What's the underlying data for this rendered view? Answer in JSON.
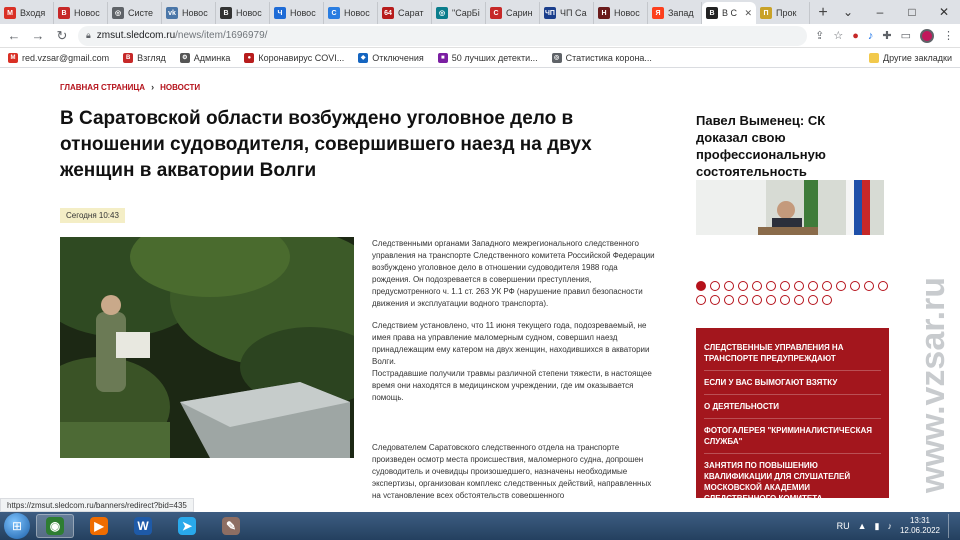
{
  "browser": {
    "tabs": [
      {
        "title": "Входя",
        "icon": "gmail-icon",
        "color": "#d93025",
        "glyph": "M"
      },
      {
        "title": "Новос",
        "icon": "vzglyad-icon",
        "color": "#c62828",
        "glyph": "В"
      },
      {
        "title": "Систе",
        "icon": "globe-icon",
        "color": "#5f6368",
        "glyph": "◎"
      },
      {
        "title": "Новос",
        "icon": "vk-icon",
        "color": "#4a76a8",
        "glyph": "vk"
      },
      {
        "title": "Новос",
        "icon": "vzglyad-icon",
        "color": "#333333",
        "glyph": "В"
      },
      {
        "title": "Новос",
        "icon": "ch-icon",
        "color": "#1e6bd6",
        "glyph": "Ч"
      },
      {
        "title": "Новос",
        "icon": "s-icon",
        "color": "#2a7de1",
        "glyph": "С"
      },
      {
        "title": "Сарат",
        "icon": "64-icon",
        "color": "#b71c1c",
        "glyph": "64"
      },
      {
        "title": "\"СарБі",
        "icon": "globe-icon",
        "color": "#0a7d8c",
        "glyph": "◎"
      },
      {
        "title": "Сарин",
        "icon": "sarinform-icon",
        "color": "#c62828",
        "glyph": "С"
      },
      {
        "title": "ЧП Са",
        "icon": "chp-icon",
        "color": "#1a3e8c",
        "glyph": "ЧП"
      },
      {
        "title": "Новос",
        "icon": "news-icon",
        "color": "#6a1b1b",
        "glyph": "Н"
      },
      {
        "title": "Запад",
        "icon": "yandex-icon",
        "color": "#fc3f1d",
        "glyph": "Я"
      },
      {
        "title": "В С",
        "icon": "sk-icon",
        "color": "#222222",
        "glyph": "В"
      },
      {
        "title": "Прок",
        "icon": "prok-icon",
        "color": "#c9a227",
        "glyph": "П"
      }
    ],
    "active_tab_index": 13,
    "new_tab_symbol": "+",
    "url_host": "zmsut.sledcom.ru",
    "url_path": "/news/item/1696979/",
    "bookmarks": [
      {
        "label": "red.vzsar@gmail.com",
        "icon": "gmail-icon",
        "color": "#d93025",
        "glyph": "M"
      },
      {
        "label": "Взгляд",
        "icon": "vzglyad-icon",
        "color": "#c62828",
        "glyph": "В"
      },
      {
        "label": "Админка",
        "icon": "gear-icon",
        "color": "#555555",
        "glyph": "⚙"
      },
      {
        "label": "Коронавирус COVI...",
        "icon": "covid-icon",
        "color": "#b71c1c",
        "glyph": "●"
      },
      {
        "label": "Отключения",
        "icon": "alert-icon",
        "color": "#1565c0",
        "glyph": "◆"
      },
      {
        "label": "50 лучших детекти...",
        "icon": "book-icon",
        "color": "#7b1fa2",
        "glyph": "■"
      },
      {
        "label": "Статистика корона...",
        "icon": "globe-icon",
        "color": "#5f6368",
        "glyph": "◎"
      }
    ],
    "other_bookmarks": "Другие закладки",
    "status_url": "https://zmsut.sledcom.ru/banners/redirect?bid=435"
  },
  "page": {
    "breadcrumbs": [
      "ГЛАВНАЯ СТРАНИЦА",
      "НОВОСТИ"
    ],
    "headline": "В Саратовской области возбуждено уголовное дело в отношении судоводителя, совершившего наезд на двух женщин в акватории Волги",
    "date": "Сегодня 10:43",
    "paragraphs": [
      "Следственными органами Западного межрегионального следственного управления на транспорте Следственного комитета Российской Федерации возбуждено уголовное дело в отношении судоводителя 1988 года рождения. Он подозревается в совершении преступления, предусмотренного ч. 1.1 ст. 263 УК РФ (нарушение правил безопасности движения и эксплуатации водного транспорта).",
      "Следствием  установлено, что 11 июня текущего года, подозреваемый, не имея права на управление маломерным судном, совершил наезд принадлежащим ему катером на двух женщин, находившихся в акватории Волги.",
      "Пострадавшие получили травмы различной степени тяжести, в настоящее время они находятся в медицинском учреждении, где им оказывается помощь."
    ],
    "paragraph_last": "Следователем Саратовского следственного отдела на транспорте произведен осмотр места происшествия, маломерного судна, допрошен судоводитель и очевидцы произошедшего, назначены необходимые экспертизы, организован комплекс следственных действий, направленных на установление всех обстоятельств совершенного",
    "sidebar": {
      "teaser_title": "Павел Выменец: СК доказал свою профессиональную состоятельность",
      "dots_total": 24,
      "dots_active_index": 0,
      "links": [
        "СЛЕДСТВЕННЫЕ УПРАВЛЕНИЯ НА ТРАНСПОРТЕ ПРЕДУПРЕЖДАЮТ",
        "ЕСЛИ У ВАС ВЫМОГАЮТ ВЗЯТКУ",
        "О ДЕЯТЕЛЬНОСТИ",
        "ФОТОГАЛЕРЕЯ \"КРИМИНАЛИСТИЧЕСКАЯ СЛУЖБА\"",
        "ЗАНЯТИЯ ПО ПОВЫШЕНИЮ КВАЛИФИКАЦИИ ДЛЯ СЛУШАТЕЛЕЙ МОСКОВСКОЙ АКАДЕМИИ СЛЕДСТВЕННОГО КОМИТЕТА"
      ]
    },
    "watermark": "www.vzsar.ru"
  },
  "taskbar": {
    "apps": [
      {
        "name": "chrome",
        "icon": "chrome-icon",
        "color": "#2e7d32",
        "glyph": "◉",
        "active": true
      },
      {
        "name": "media",
        "icon": "media-player-icon",
        "color": "#ef6c00",
        "glyph": "▶",
        "active": false
      },
      {
        "name": "word",
        "icon": "word-icon",
        "color": "#1e5aa8",
        "glyph": "W",
        "active": false
      },
      {
        "name": "telegram",
        "icon": "telegram-icon",
        "color": "#29a9eb",
        "glyph": "➤",
        "active": false
      },
      {
        "name": "paint",
        "icon": "paint-icon",
        "color": "#8d6e63",
        "glyph": "✎",
        "active": false
      }
    ],
    "lang": "RU",
    "time": "13:31",
    "date": "12.06.2022"
  },
  "colors": {
    "brand_red": "#a3161d",
    "crumb_red": "#b5121b",
    "date_bg": "#f4eec6"
  }
}
